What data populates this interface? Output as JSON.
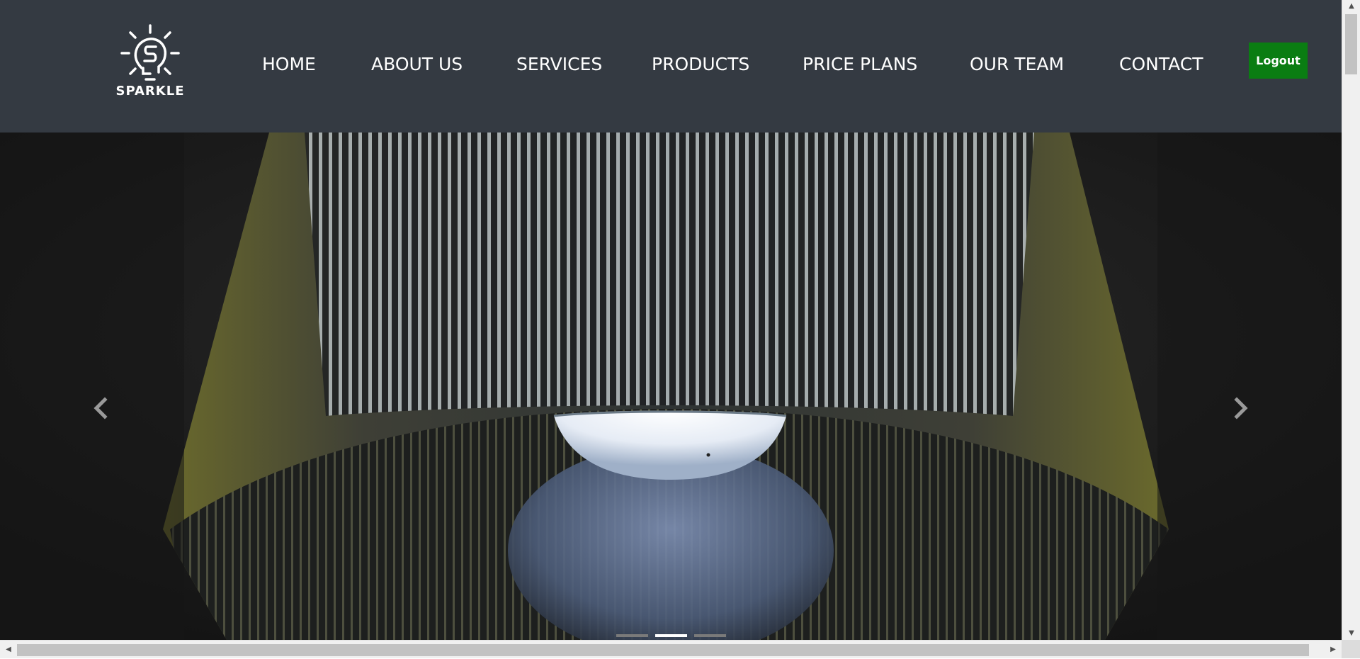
{
  "brand": {
    "name": "SPARKLE",
    "logo_icon": "lightbulb-s-icon"
  },
  "nav": {
    "items": [
      {
        "label": "HOME"
      },
      {
        "label": "ABOUT US"
      },
      {
        "label": "SERVICES"
      },
      {
        "label": "PRODUCTS"
      },
      {
        "label": "PRICE PLANS"
      },
      {
        "label": "OUR TEAM"
      },
      {
        "label": "CONTACT"
      }
    ],
    "logout_label": "Logout"
  },
  "carousel": {
    "prev_icon": "chevron-left-icon",
    "next_icon": "chevron-right-icon",
    "slide_count": 3,
    "active_index": 1
  },
  "colors": {
    "navbar_bg": "#343a42",
    "logout_bg": "#0a7d12",
    "hero_bg": "#1a1a1a"
  }
}
